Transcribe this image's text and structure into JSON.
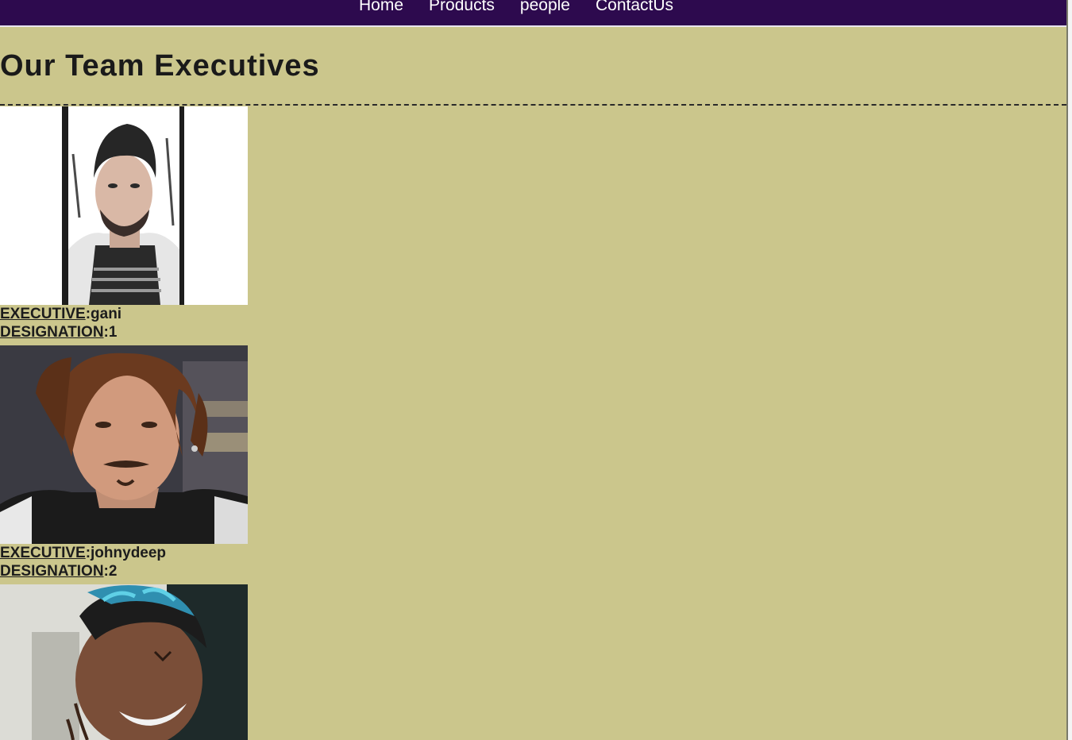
{
  "nav": {
    "items": [
      "Home",
      "Products",
      "people",
      "ContactUs"
    ]
  },
  "page_title": "Our Team Executives",
  "labels": {
    "executive": "EXECUTIVE",
    "designation": "DESIGNATION"
  },
  "executives": [
    {
      "name": "gani",
      "designation": "1"
    },
    {
      "name": "johnydeep",
      "designation": "2"
    },
    {
      "name": "",
      "designation": ""
    }
  ],
  "colors": {
    "navbar": "#2d0a4e",
    "background": "#cbc68c",
    "nav_text": "#ffffff"
  }
}
